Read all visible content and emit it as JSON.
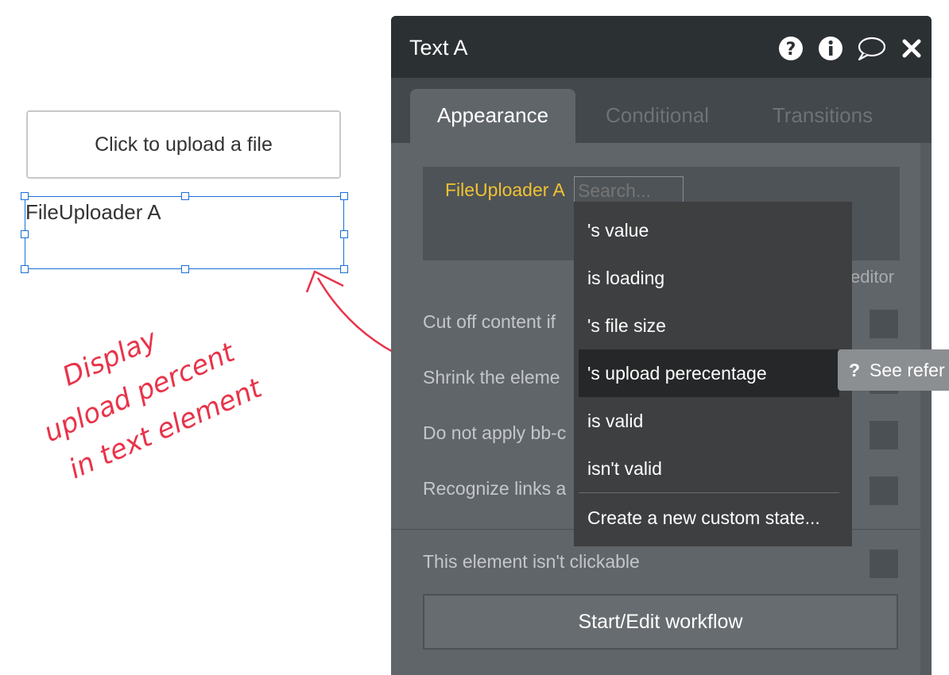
{
  "canvas": {
    "upload_button_label": "Click to upload a file",
    "text_element_text": "FileUploader A",
    "annotation_lines": [
      "Display",
      "upload percent",
      "in text element"
    ]
  },
  "panel": {
    "title": "Text A",
    "header_icons": [
      "help-icon",
      "info-icon",
      "comment-icon",
      "close-icon"
    ],
    "tabs": [
      {
        "label": "Appearance",
        "active": true
      },
      {
        "label": "Conditional",
        "active": false
      },
      {
        "label": "Transitions",
        "active": false
      }
    ],
    "expression": {
      "source": "FileUploader A",
      "search_placeholder": "Search..."
    },
    "editor_link": "editor",
    "properties": [
      {
        "label": "Cut off content if"
      },
      {
        "label": "Shrink the eleme"
      },
      {
        "label": "Do not apply bb-c"
      },
      {
        "label": "Recognize links a"
      },
      {
        "label": "This element isn't clickable"
      }
    ],
    "workflow_button": "Start/Edit workflow"
  },
  "dropdown": {
    "items": [
      {
        "label": "'s value"
      },
      {
        "label": " is loading"
      },
      {
        "label": "'s file size"
      },
      {
        "label": "'s upload perecentage",
        "highlighted": true
      },
      {
        "label": " is valid"
      },
      {
        "label": " isn't valid"
      },
      {
        "label": "Create a new custom state..."
      }
    ]
  },
  "tooltip": {
    "label": "See refer"
  },
  "colors": {
    "selection_blue": "#1a6fd8",
    "annotation_red": "#e8344a",
    "expression_yellow": "#f1c232",
    "panel_header": "#2b3033"
  }
}
